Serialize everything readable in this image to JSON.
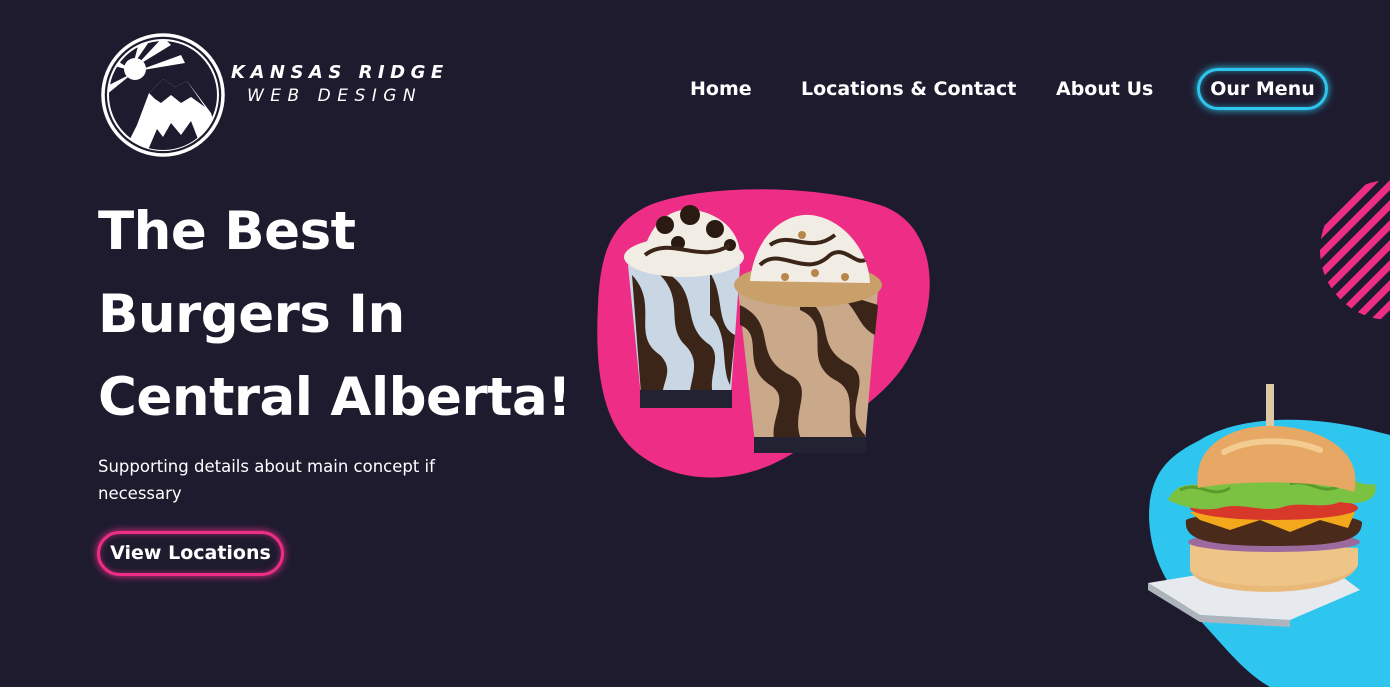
{
  "brand": {
    "name_line1": "KANSAS RIDGE",
    "name_line2": "WEB DESIGN",
    "logo_icon": "sun-mountain-logo-icon"
  },
  "nav": {
    "items": [
      {
        "label": "Home"
      },
      {
        "label": "Locations & Contact"
      },
      {
        "label": "About Us"
      },
      {
        "label": "Our Menu"
      }
    ]
  },
  "hero": {
    "title": "The Best Burgers In Central Alberta!",
    "subtitle": "Supporting details about main concept if necessary",
    "cta_label": "View Locations"
  },
  "images": {
    "milkshakes": "milkshakes-image",
    "burger": "burger-image",
    "stripes": "striped-circle-decoration"
  },
  "colors": {
    "background": "#1e1b2f",
    "accent_pink": "#ee2e86",
    "accent_cyan": "#2ec6ee",
    "text": "#ffffff"
  }
}
